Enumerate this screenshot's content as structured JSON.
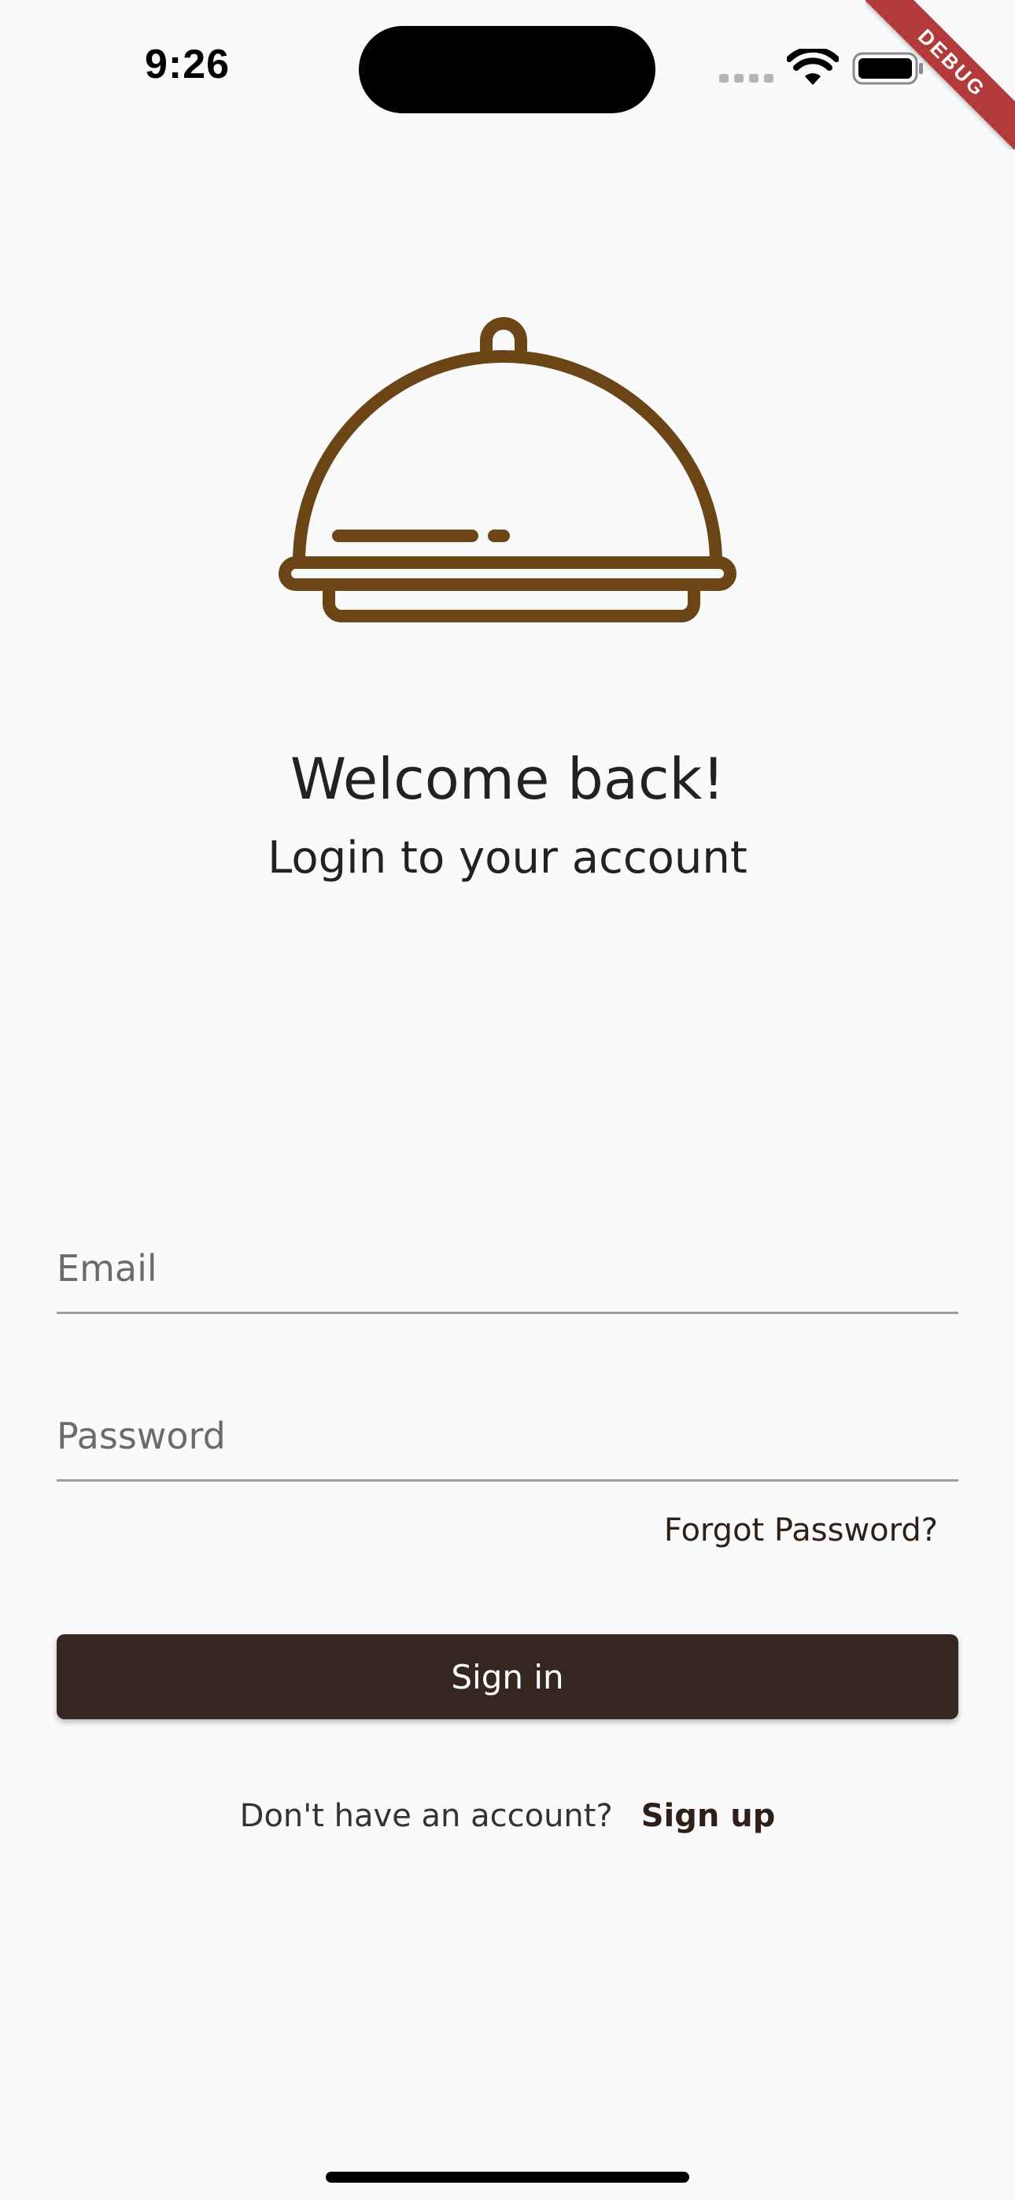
{
  "status_bar": {
    "time": "9:26",
    "icons": [
      "cellular-signal-icon",
      "wifi-icon",
      "battery-icon"
    ]
  },
  "debug_banner": "DEBUG",
  "logo": {
    "icon": "food-cloche-icon",
    "color": "#6b4516"
  },
  "header": {
    "welcome": "Welcome back!",
    "subtitle": "Login to your account"
  },
  "form": {
    "email_placeholder": "Email",
    "email_value": "",
    "password_placeholder": "Password",
    "password_value": "",
    "forgot_password": "Forgot Password?",
    "sign_in": "Sign in"
  },
  "footer": {
    "prompt": "Don't have an account?",
    "sign_up": "Sign up"
  },
  "colors": {
    "background": "#fafafa",
    "primary_button": "#362620",
    "brand": "#6b4516",
    "debug": "#b23a3a"
  }
}
